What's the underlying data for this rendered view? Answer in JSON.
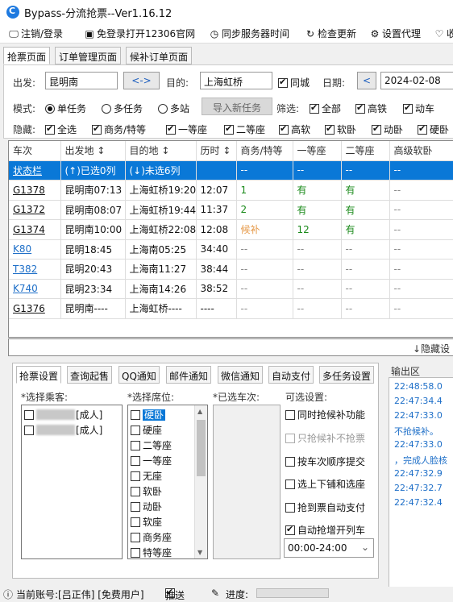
{
  "app": {
    "title": "Bypass-分流抢票--Ver1.16.12"
  },
  "menu": {
    "login": "注销/登录",
    "open_site": "免登录打开12306官网",
    "sync_time": "同步服务器时间",
    "check_update": "检查更新",
    "proxy": "设置代理",
    "more": "收"
  },
  "main_tabs": [
    "抢票页面",
    "订单管理页面",
    "候补订单页面"
  ],
  "search": {
    "from_label": "出发:",
    "from_value": "昆明南",
    "swap_label": "<->",
    "to_label": "目的:",
    "to_value": "上海虹桥",
    "same_city": "同城",
    "date_label": "日期:",
    "date_prev": "<",
    "date_value": "2024-02-08"
  },
  "mode": {
    "label": "模式:",
    "options": [
      "单任务",
      "多任务",
      "多站"
    ],
    "selected": "单任务",
    "import_button": "导入新任务",
    "filter_label": "筛选:",
    "filters": [
      "全部",
      "高铁",
      "动车"
    ]
  },
  "hide": {
    "label": "隐藏:",
    "items": [
      "全选",
      "商务/特等",
      "一等座",
      "二等座",
      "高软",
      "软卧",
      "动卧",
      "硬卧"
    ]
  },
  "table": {
    "headers": [
      "车次",
      "出发地 ↕",
      "目的地 ↕",
      "历时 ↕",
      "商务/特等",
      "一等座",
      "二等座",
      "高级软卧"
    ],
    "rows": [
      [
        "状态栏",
        "(↑)已选0列",
        "(↓)未选6列",
        "",
        "--",
        "--",
        "--",
        "--"
      ],
      [
        "G1378",
        "昆明南07:13",
        "上海虹桥19:20",
        "12:07",
        "1",
        "有",
        "有",
        "--"
      ],
      [
        "G1372",
        "昆明南08:07",
        "上海虹桥19:44",
        "11:37",
        "2",
        "有",
        "有",
        "--"
      ],
      [
        "G1374",
        "昆明南10:00",
        "上海虹桥22:08",
        "12:08",
        "候补",
        "12",
        "有",
        "--"
      ],
      [
        "K80",
        "昆明18:45",
        "上海南05:25",
        "34:40",
        "--",
        "--",
        "--",
        "--"
      ],
      [
        "T382",
        "昆明20:43",
        "上海南11:27",
        "38:44",
        "--",
        "--",
        "--",
        "--"
      ],
      [
        "K740",
        "昆明23:34",
        "上海南14:26",
        "38:52",
        "--",
        "--",
        "--",
        "--"
      ],
      [
        "G1376",
        "昆明南----",
        "上海虹桥----",
        "----",
        "--",
        "--",
        "--",
        "--"
      ]
    ],
    "footer": "↓隐藏设"
  },
  "settings_tabs": [
    "抢票设置",
    "查询起售",
    "QQ通知",
    "邮件通知",
    "微信通知",
    "自动支付",
    "多任务设置"
  ],
  "settings": {
    "passenger_label": "*选择乘客:",
    "passengers": [
      "[成人]",
      "[成人]"
    ],
    "seat_label": "*选择席位:",
    "seats": [
      "硬卧",
      "硬座",
      "二等座",
      "一等座",
      "无座",
      "软卧",
      "动卧",
      "软座",
      "商务座",
      "特等座"
    ],
    "train_label": "*已选车次:",
    "options_label": "可选设置:",
    "options": [
      {
        "label": "同时抢候补功能",
        "checked": false,
        "enabled": true
      },
      {
        "label": "只抢候补不抢票",
        "checked": false,
        "enabled": false
      },
      {
        "label": "按车次顺序提交",
        "checked": false,
        "enabled": true
      },
      {
        "label": "选上下铺和选座",
        "checked": false,
        "enabled": true
      },
      {
        "label": "抢到票自动支付",
        "checked": false,
        "enabled": true
      },
      {
        "label": "自动抢增开列车",
        "checked": true,
        "enabled": true
      }
    ],
    "time_range": "00:00-24:00"
  },
  "output": {
    "label": "输出区",
    "lines": [
      "22:48:58.0",
      "22:47:34.4",
      "22:47:33.0",
      "不抢候补。",
      "22:47:33.0",
      "，完成人脸核",
      "22:47:32.9",
      "22:47:32.7",
      "22:47:32.4"
    ]
  },
  "status": {
    "account": "当前账号:[吕正伟] [免费用户]",
    "push": "推送",
    "progress": "进度:"
  }
}
